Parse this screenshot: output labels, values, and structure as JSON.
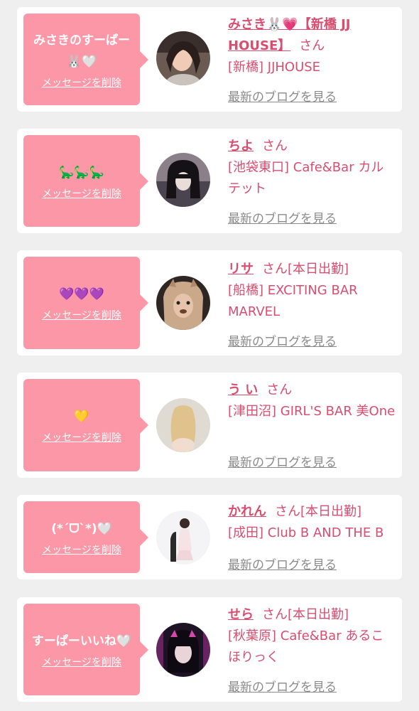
{
  "entries": [
    {
      "message": "みさきのすーぱー🐰🤍",
      "delete_label": "メッセージを削除",
      "name": "みさき🐰💗【新橋 JJ HOUSE】",
      "honorific": "さん",
      "work_status": "",
      "shop": "[新橋] JJHOUSE",
      "blog_label": "最新のブログを見る"
    },
    {
      "message": "🦕🦕🦕",
      "delete_label": "メッセージを削除",
      "name": "ちよ",
      "honorific": "さん",
      "work_status": "",
      "shop": "[池袋東口] Cafe&Bar カルテット",
      "blog_label": "最新のブログを見る"
    },
    {
      "message": "💜💜💜",
      "delete_label": "メッセージを削除",
      "name": "リサ",
      "honorific": "さん",
      "work_status": "[本日出勤]",
      "shop": "[船橋] EXCITING BAR MARVEL",
      "blog_label": "最新のブログを見る"
    },
    {
      "message": "💛",
      "delete_label": "メッセージを削除",
      "name": "う い",
      "honorific": "さん",
      "work_status": "",
      "shop": "[津田沼] GIRL'S BAR 美One",
      "blog_label": "最新のブログを見る"
    },
    {
      "message": "(*´ᗜ`*)🤍",
      "delete_label": "メッセージを削除",
      "name": "かれん",
      "honorific": "さん",
      "work_status": "[本日出勤]",
      "shop": "[成田] Club B AND THE B",
      "blog_label": "最新のブログを見る"
    },
    {
      "message": "すーぱーいいね🤍",
      "delete_label": "メッセージを削除",
      "name": "せら",
      "honorific": "さん",
      "work_status": "[本日出勤]",
      "shop": "[秋葉原] Cafe&Bar あるこほりっく",
      "blog_label": "最新のブログを見る"
    }
  ],
  "colors": {
    "page_background": "#efefef",
    "card_background": "#ffffff",
    "bubble": "#fc97a7",
    "accent": "#d94d6f",
    "link_gray": "#8a8a8a"
  },
  "icons": {
    "avatar": "profile-photo"
  }
}
